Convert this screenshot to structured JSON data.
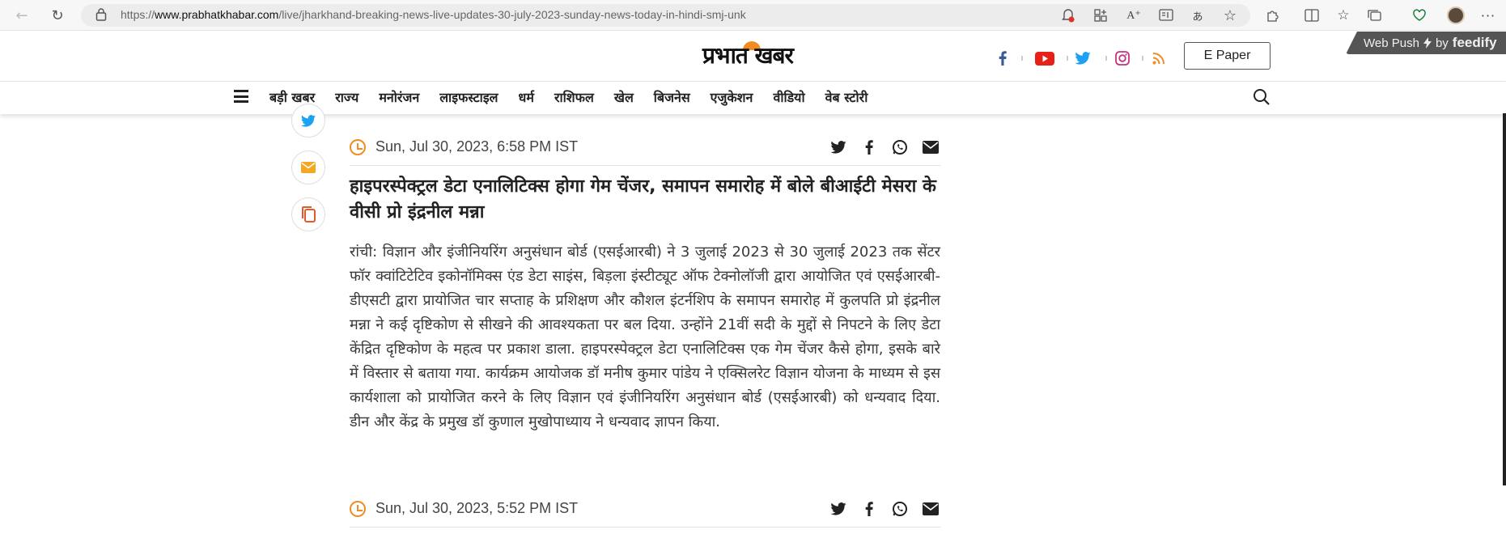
{
  "browser": {
    "url_prefix": "https://",
    "url_host": "www.prabhatkhabar.com",
    "url_path": "/live/jharkhand-breaking-news-live-updates-30-july-2023-sunday-news-today-in-hindi-smj-unk"
  },
  "header": {
    "logo_text": "प्रभात खबर",
    "epaper_label": "E Paper",
    "webpush_prefix": "Web Push",
    "webpush_by": "by",
    "webpush_brand": "feedify",
    "social_icons": [
      "facebook-icon",
      "youtube-icon",
      "twitter-icon",
      "instagram-icon",
      "rss-icon"
    ],
    "colors": {
      "facebook": "#3b5998",
      "youtube": "#e62117",
      "twitter": "#1da1f2",
      "instagram": "#c13584",
      "rss": "#f28b22"
    }
  },
  "nav": {
    "items": [
      "बड़ी खबर",
      "राज्य",
      "मनोरंजन",
      "लाइफस्टाइल",
      "धर्म",
      "राशिफल",
      "खेल",
      "बिजनेस",
      "एजुकेशन",
      "वीडियो",
      "वेब स्टोरी"
    ]
  },
  "share_rail": [
    "twitter-icon",
    "mail-icon",
    "copy-icon"
  ],
  "posts": [
    {
      "time": "Sun, Jul 30, 2023, 6:58 PM IST",
      "title": "हाइपरस्पेक्ट्रल डेटा एनालिटिक्स होगा गेम चेंजर, समापन समारोह में बोले बीआईटी मेसरा के वीसी प्रो इंद्रनील मन्ना",
      "body": "रांची: विज्ञान और इंजीनियरिंग अनुसंधान बोर्ड (एसईआरबी) ने 3 जुलाई 2023 से 30 जुलाई 2023 तक सेंटर फॉर क्वांटिटेटिव इकोनॉमिक्स एंड डेटा साइंस, बिड़ला इंस्टीट्यूट ऑफ टेक्नोलॉजी द्वारा आयोजित एवं एसईआरबी-डीएसटी द्वारा प्रायोजित चार सप्ताह के प्रशिक्षण और कौशल इंटर्नशिप के समापन समारोह में कुलपति प्रो इंद्रनील मन्ना ने कई दृष्टिकोण से सीखने की आवश्यकता पर बल दिया. उन्होंने 21वीं सदी के मुद्दों से निपटने के लिए डेटा केंद्रित दृष्टिकोण के महत्व पर प्रकाश डाला. हाइपरस्पेक्ट्रल डेटा एनालिटिक्स एक गेम चेंजर कैसे होगा, इसके बारे में विस्तार से बताया गया. कार्यक्रम आयोजक डॉ मनीष कुमार पांडेय ने एक्सिलरेट विज्ञान योजना के माध्यम से इस कार्यशाला को प्रायोजित करने के लिए विज्ञान एवं इंजीनियरिंग अनुसंधान बोर्ड (एसईआरबी) को धन्यवाद दिया. डीन और केंद्र के प्रमुख डॉ कुणाल मुखोपाध्याय ने धन्यवाद ज्ञापन किया."
    },
    {
      "time": "Sun, Jul 30, 2023, 5:52 PM IST"
    }
  ]
}
